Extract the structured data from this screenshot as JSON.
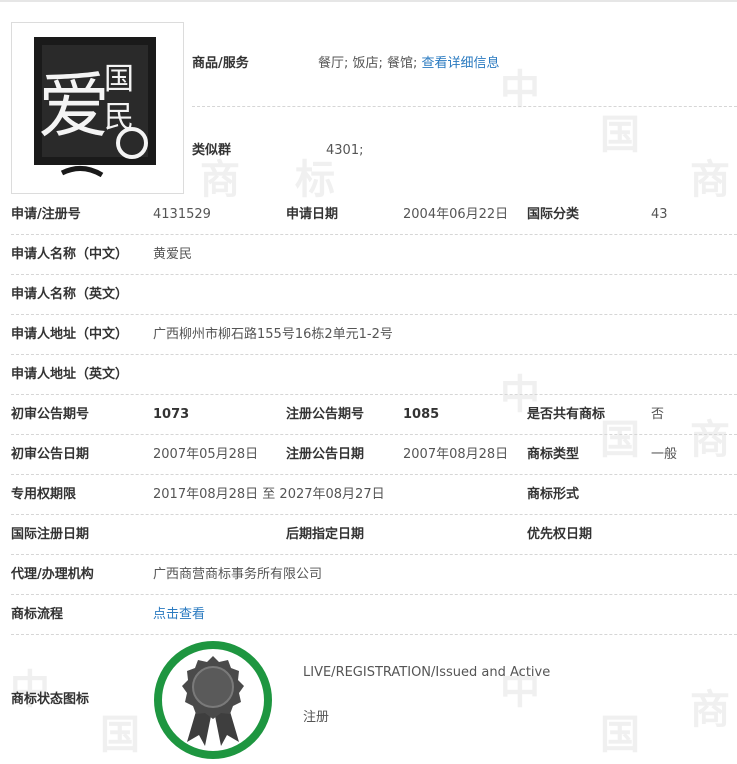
{
  "watermark": {
    "chars": [
      "中",
      "国",
      "商",
      "标"
    ]
  },
  "goods_services": {
    "label": "商品/服务",
    "value": "餐厅; 饭店; 餐馆;",
    "link": "查看详细信息"
  },
  "similar_group": {
    "label": "类似群",
    "value": "4301;"
  },
  "row_app_no": {
    "label": "申请/注册号",
    "value": "4131529",
    "label2": "申请日期",
    "value2": "2004年06月22日",
    "label3": "国际分类",
    "value3": "43"
  },
  "applicant_cn": {
    "label": "申请人名称（中文）",
    "value": "黄爱民"
  },
  "applicant_en": {
    "label": "申请人名称（英文）",
    "value": ""
  },
  "address_cn": {
    "label": "申请人地址（中文）",
    "value": "广西柳州市柳石路155号16栋2单元1-2号"
  },
  "address_en": {
    "label": "申请人地址（英文）",
    "value": ""
  },
  "row_announce_no": {
    "label": "初审公告期号",
    "value": "1073",
    "label2": "注册公告期号",
    "value2": "1085",
    "label3": "是否共有商标",
    "value3": "否"
  },
  "row_announce_date": {
    "label": "初审公告日期",
    "value": "2007年05月28日",
    "label2": "注册公告日期",
    "value2": "2007年08月28日",
    "label3": "商标类型",
    "value3": "一般"
  },
  "row_exclusive": {
    "label": "专用权期限",
    "value": "2017年08月28日 至 2027年08月27日",
    "label3": "商标形式",
    "value3": ""
  },
  "row_intl": {
    "label": "国际注册日期",
    "label2": "后期指定日期",
    "label3": "优先权日期"
  },
  "agent": {
    "label": "代理/办理机构",
    "value": "广西商营商标事务所有限公司"
  },
  "process": {
    "label": "商标流程",
    "link": "点击查看"
  },
  "status": {
    "label": "商标状态图标",
    "text_en": "LIVE/REGISTRATION/Issued and Active",
    "text_cn": "注册"
  },
  "logo": {
    "glyphs": [
      "爱",
      "国",
      "民"
    ]
  },
  "colors": {
    "link": "#2a7ac0",
    "status_ring": "#1e9640",
    "badge": "#4a4a4a"
  }
}
